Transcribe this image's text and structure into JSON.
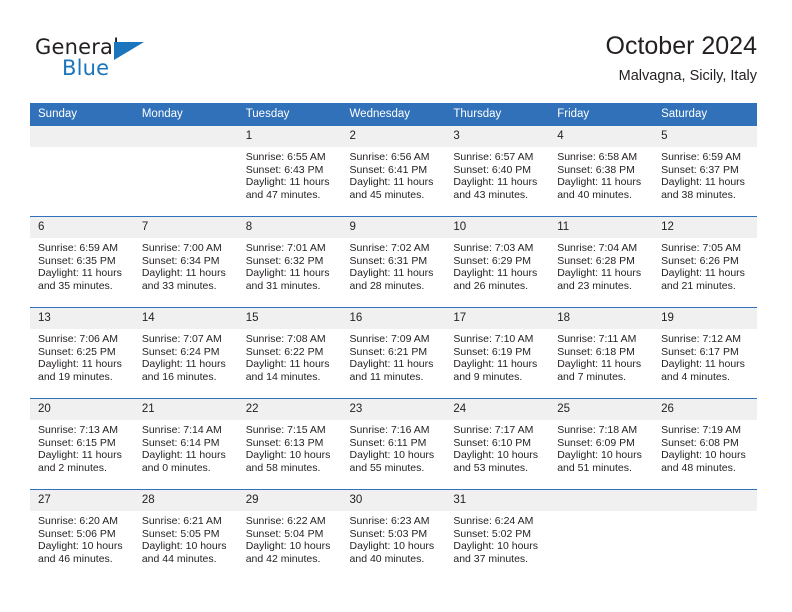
{
  "brand": {
    "word_top": "General",
    "word_bottom": "Blue",
    "accent_color": "#1b75bc"
  },
  "header": {
    "title": "October 2024",
    "subtitle": "Malvagna, Sicily, Italy"
  },
  "theme": {
    "header_blue": "#3071b9",
    "daynum_band": "#f0f0f0",
    "text": "#231f20"
  },
  "labels": {
    "sunrise_prefix": "Sunrise:",
    "sunset_prefix": "Sunset:",
    "daylight_prefix": "Daylight:"
  },
  "weekdays": [
    "Sunday",
    "Monday",
    "Tuesday",
    "Wednesday",
    "Thursday",
    "Friday",
    "Saturday"
  ],
  "weeks": [
    [
      {
        "day": "",
        "sunrise": "",
        "sunset": "",
        "daylight": "",
        "blank": true
      },
      {
        "day": "",
        "sunrise": "",
        "sunset": "",
        "daylight": "",
        "blank": true
      },
      {
        "day": "1",
        "sunrise": "Sunrise: 6:55 AM",
        "sunset": "Sunset: 6:43 PM",
        "daylight": "Daylight: 11 hours and 47 minutes."
      },
      {
        "day": "2",
        "sunrise": "Sunrise: 6:56 AM",
        "sunset": "Sunset: 6:41 PM",
        "daylight": "Daylight: 11 hours and 45 minutes."
      },
      {
        "day": "3",
        "sunrise": "Sunrise: 6:57 AM",
        "sunset": "Sunset: 6:40 PM",
        "daylight": "Daylight: 11 hours and 43 minutes."
      },
      {
        "day": "4",
        "sunrise": "Sunrise: 6:58 AM",
        "sunset": "Sunset: 6:38 PM",
        "daylight": "Daylight: 11 hours and 40 minutes."
      },
      {
        "day": "5",
        "sunrise": "Sunrise: 6:59 AM",
        "sunset": "Sunset: 6:37 PM",
        "daylight": "Daylight: 11 hours and 38 minutes."
      }
    ],
    [
      {
        "day": "6",
        "sunrise": "Sunrise: 6:59 AM",
        "sunset": "Sunset: 6:35 PM",
        "daylight": "Daylight: 11 hours and 35 minutes."
      },
      {
        "day": "7",
        "sunrise": "Sunrise: 7:00 AM",
        "sunset": "Sunset: 6:34 PM",
        "daylight": "Daylight: 11 hours and 33 minutes."
      },
      {
        "day": "8",
        "sunrise": "Sunrise: 7:01 AM",
        "sunset": "Sunset: 6:32 PM",
        "daylight": "Daylight: 11 hours and 31 minutes."
      },
      {
        "day": "9",
        "sunrise": "Sunrise: 7:02 AM",
        "sunset": "Sunset: 6:31 PM",
        "daylight": "Daylight: 11 hours and 28 minutes."
      },
      {
        "day": "10",
        "sunrise": "Sunrise: 7:03 AM",
        "sunset": "Sunset: 6:29 PM",
        "daylight": "Daylight: 11 hours and 26 minutes."
      },
      {
        "day": "11",
        "sunrise": "Sunrise: 7:04 AM",
        "sunset": "Sunset: 6:28 PM",
        "daylight": "Daylight: 11 hours and 23 minutes."
      },
      {
        "day": "12",
        "sunrise": "Sunrise: 7:05 AM",
        "sunset": "Sunset: 6:26 PM",
        "daylight": "Daylight: 11 hours and 21 minutes."
      }
    ],
    [
      {
        "day": "13",
        "sunrise": "Sunrise: 7:06 AM",
        "sunset": "Sunset: 6:25 PM",
        "daylight": "Daylight: 11 hours and 19 minutes."
      },
      {
        "day": "14",
        "sunrise": "Sunrise: 7:07 AM",
        "sunset": "Sunset: 6:24 PM",
        "daylight": "Daylight: 11 hours and 16 minutes."
      },
      {
        "day": "15",
        "sunrise": "Sunrise: 7:08 AM",
        "sunset": "Sunset: 6:22 PM",
        "daylight": "Daylight: 11 hours and 14 minutes."
      },
      {
        "day": "16",
        "sunrise": "Sunrise: 7:09 AM",
        "sunset": "Sunset: 6:21 PM",
        "daylight": "Daylight: 11 hours and 11 minutes."
      },
      {
        "day": "17",
        "sunrise": "Sunrise: 7:10 AM",
        "sunset": "Sunset: 6:19 PM",
        "daylight": "Daylight: 11 hours and 9 minutes."
      },
      {
        "day": "18",
        "sunrise": "Sunrise: 7:11 AM",
        "sunset": "Sunset: 6:18 PM",
        "daylight": "Daylight: 11 hours and 7 minutes."
      },
      {
        "day": "19",
        "sunrise": "Sunrise: 7:12 AM",
        "sunset": "Sunset: 6:17 PM",
        "daylight": "Daylight: 11 hours and 4 minutes."
      }
    ],
    [
      {
        "day": "20",
        "sunrise": "Sunrise: 7:13 AM",
        "sunset": "Sunset: 6:15 PM",
        "daylight": "Daylight: 11 hours and 2 minutes."
      },
      {
        "day": "21",
        "sunrise": "Sunrise: 7:14 AM",
        "sunset": "Sunset: 6:14 PM",
        "daylight": "Daylight: 11 hours and 0 minutes."
      },
      {
        "day": "22",
        "sunrise": "Sunrise: 7:15 AM",
        "sunset": "Sunset: 6:13 PM",
        "daylight": "Daylight: 10 hours and 58 minutes."
      },
      {
        "day": "23",
        "sunrise": "Sunrise: 7:16 AM",
        "sunset": "Sunset: 6:11 PM",
        "daylight": "Daylight: 10 hours and 55 minutes."
      },
      {
        "day": "24",
        "sunrise": "Sunrise: 7:17 AM",
        "sunset": "Sunset: 6:10 PM",
        "daylight": "Daylight: 10 hours and 53 minutes."
      },
      {
        "day": "25",
        "sunrise": "Sunrise: 7:18 AM",
        "sunset": "Sunset: 6:09 PM",
        "daylight": "Daylight: 10 hours and 51 minutes."
      },
      {
        "day": "26",
        "sunrise": "Sunrise: 7:19 AM",
        "sunset": "Sunset: 6:08 PM",
        "daylight": "Daylight: 10 hours and 48 minutes."
      }
    ],
    [
      {
        "day": "27",
        "sunrise": "Sunrise: 6:20 AM",
        "sunset": "Sunset: 5:06 PM",
        "daylight": "Daylight: 10 hours and 46 minutes."
      },
      {
        "day": "28",
        "sunrise": "Sunrise: 6:21 AM",
        "sunset": "Sunset: 5:05 PM",
        "daylight": "Daylight: 10 hours and 44 minutes."
      },
      {
        "day": "29",
        "sunrise": "Sunrise: 6:22 AM",
        "sunset": "Sunset: 5:04 PM",
        "daylight": "Daylight: 10 hours and 42 minutes."
      },
      {
        "day": "30",
        "sunrise": "Sunrise: 6:23 AM",
        "sunset": "Sunset: 5:03 PM",
        "daylight": "Daylight: 10 hours and 40 minutes."
      },
      {
        "day": "31",
        "sunrise": "Sunrise: 6:24 AM",
        "sunset": "Sunset: 5:02 PM",
        "daylight": "Daylight: 10 hours and 37 minutes."
      },
      {
        "day": "",
        "sunrise": "",
        "sunset": "",
        "daylight": "",
        "blank": true
      },
      {
        "day": "",
        "sunrise": "",
        "sunset": "",
        "daylight": "",
        "blank": true
      }
    ]
  ]
}
